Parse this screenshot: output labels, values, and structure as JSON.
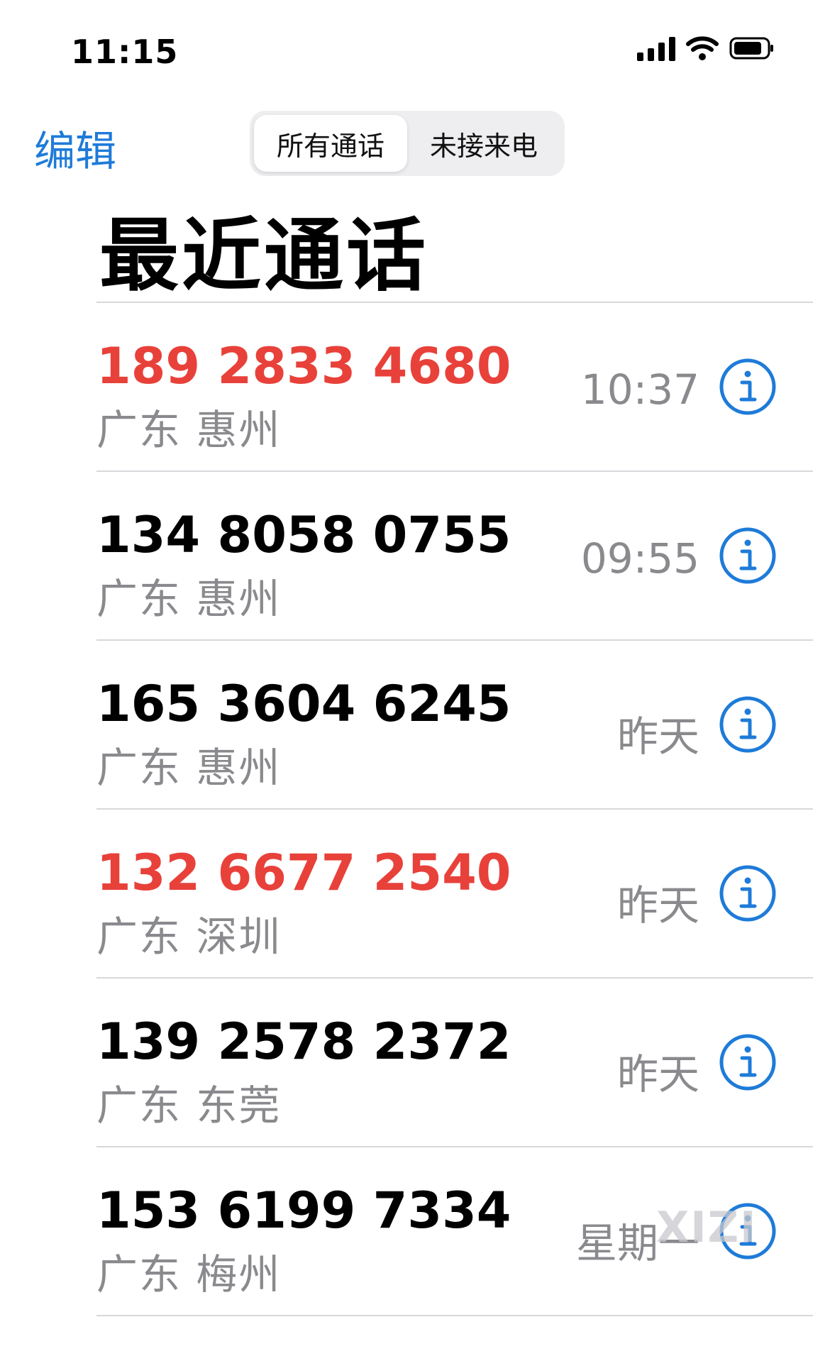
{
  "status_bar": {
    "time": "11:15"
  },
  "header": {
    "edit_label": "编辑",
    "segments": [
      {
        "label": "所有通话",
        "active": true
      },
      {
        "label": "未接来电",
        "active": false
      }
    ],
    "title": "最近通话"
  },
  "calls": [
    {
      "number": "189 2833 4680",
      "location": "广东 惠州",
      "time": "10:37",
      "missed": true
    },
    {
      "number": "134 8058 0755",
      "location": "广东 惠州",
      "time": "09:55",
      "missed": false
    },
    {
      "number": "165 3604 6245",
      "location": "广东 惠州",
      "time": "昨天",
      "missed": false
    },
    {
      "number": "132 6677 2540",
      "location": "广东 深圳",
      "time": "昨天",
      "missed": true
    },
    {
      "number": "139 2578 2372",
      "location": "广东 东莞",
      "time": "昨天",
      "missed": false
    },
    {
      "number": "153 6199 7334",
      "location": "广东 梅州",
      "time": "星期一",
      "missed": false
    }
  ],
  "watermark": "XIZI",
  "colors": {
    "accent": "#1e7bd8",
    "missed": "#e8413a",
    "secondary_text": "#8a8a8e"
  },
  "icons": {
    "info": "info-circle-icon",
    "signal": "cellular-signal-icon",
    "wifi": "wifi-icon",
    "battery": "battery-icon"
  }
}
